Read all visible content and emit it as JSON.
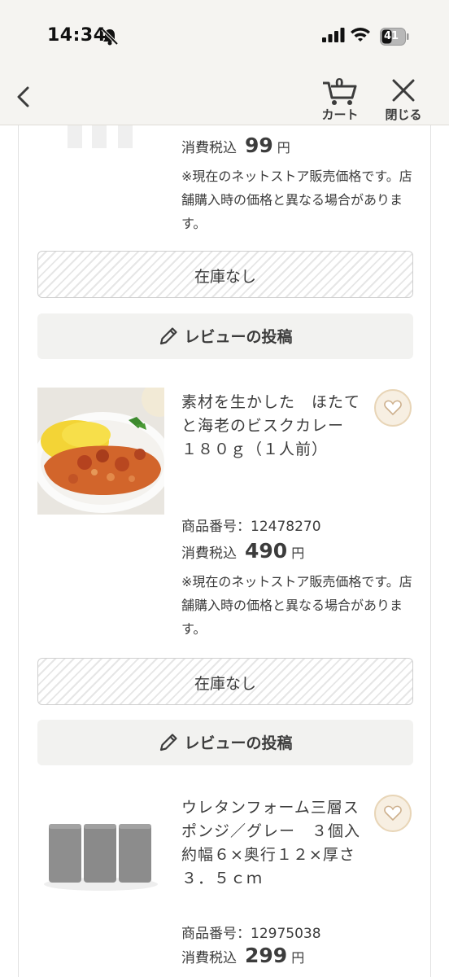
{
  "status_bar": {
    "time": "14:34",
    "battery": "41"
  },
  "header": {
    "cart_count": "0",
    "cart_label": "カート",
    "close_label": "閉じる"
  },
  "products": [
    {
      "price_label": "消費税込",
      "price": "99",
      "price_unit": "円",
      "note": "※現在のネットストア販売価格です。店舗購入時の価格と異なる場合があります。",
      "stock_label": "在庫なし",
      "review_label": "レビューの投稿"
    },
    {
      "title": "素材を生かした　ほたてと海老のビスクカレー　１８０ｇ（１人前）",
      "code": "商品番号：12478270",
      "price_label": "消費税込",
      "price": "490",
      "price_unit": "円",
      "note": "※現在のネットストア販売価格です。店舗購入時の価格と異なる場合があります。",
      "stock_label": "在庫なし",
      "review_label": "レビューの投稿"
    },
    {
      "title": "ウレタンフォーム三層スポンジ／グレー　３個入　約幅６×奥行１２×厚さ３．５ｃｍ",
      "code": "商品番号：12975038",
      "price_label": "消費税込",
      "price": "299",
      "price_unit": "円"
    }
  ],
  "colors": {
    "accent_heart_bg": "#f7efe2",
    "accent_heart_border": "#e8d5b7",
    "text": "#3c3c3c",
    "header_bg": "#f5f4f1"
  }
}
